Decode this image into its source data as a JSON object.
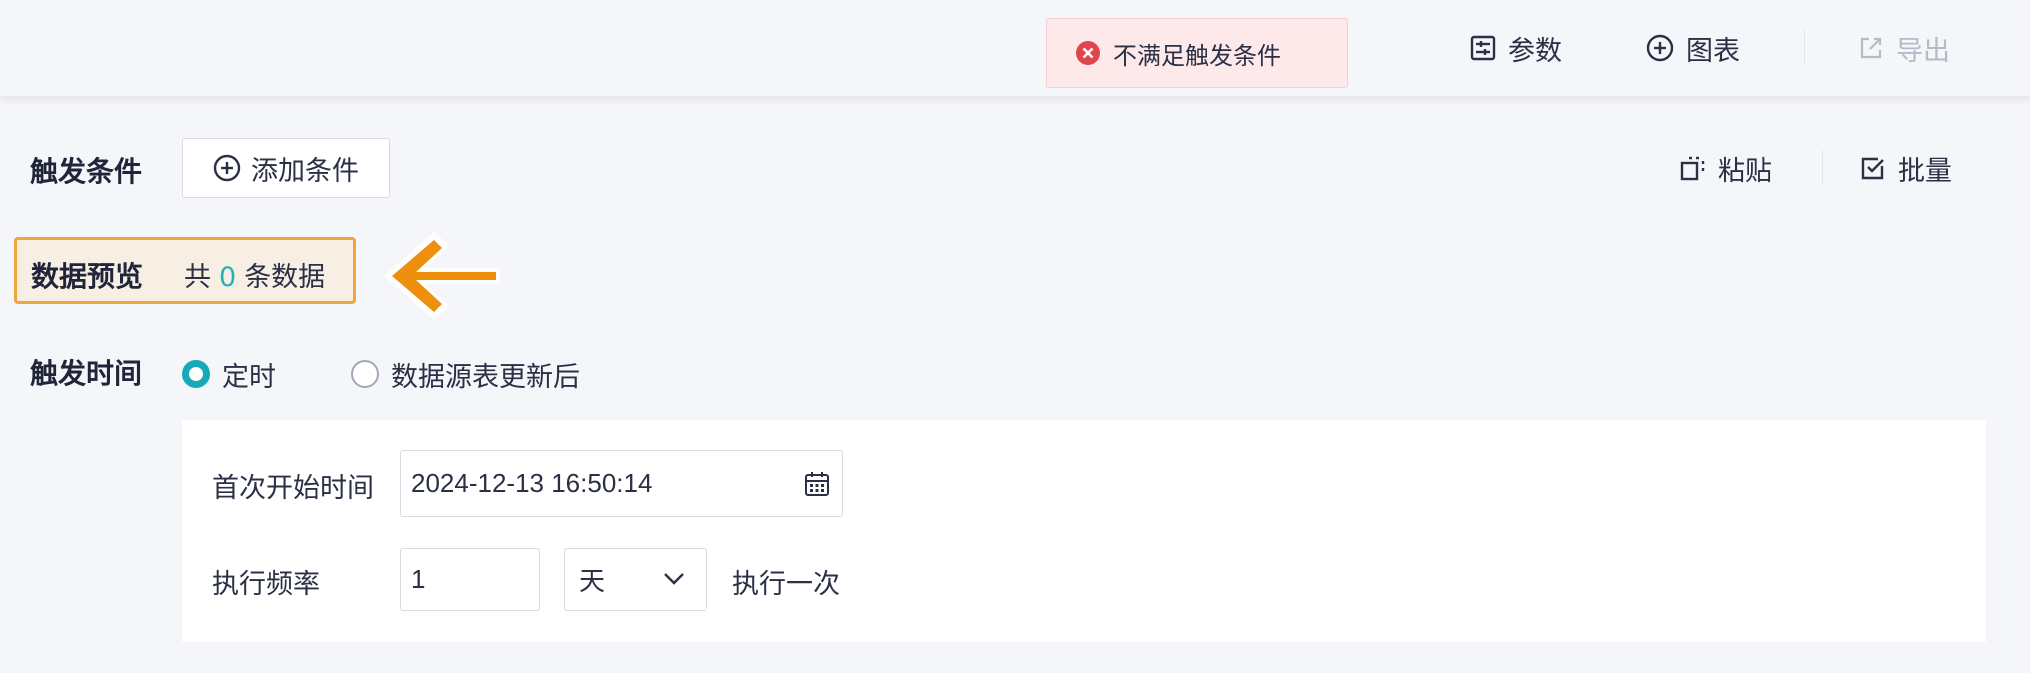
{
  "toolbar": {
    "params_label": "参数",
    "chart_label": "图表",
    "export_label": "导出"
  },
  "toast": {
    "message": "不满足触发条件"
  },
  "trigger_condition": {
    "label": "触发条件",
    "add_button": "添加条件",
    "paste_label": "粘贴",
    "batch_label": "批量"
  },
  "data_preview": {
    "label": "数据预览",
    "prefix": "共",
    "count": "0",
    "suffix": "条数据"
  },
  "trigger_time": {
    "label": "触发时间",
    "options": [
      "定时",
      "数据源表更新后"
    ],
    "selected": "定时"
  },
  "schedule": {
    "start_label": "首次开始时间",
    "start_value": "2024-12-13 16:50:14",
    "freq_label": "执行频率",
    "freq_value": "1",
    "unit_value": "天",
    "freq_suffix": "执行一次"
  },
  "colors": {
    "accent": "#16a9b8",
    "highlight": "#f0a640",
    "arrow": "#ee8f0d",
    "error": "#e2444c"
  }
}
